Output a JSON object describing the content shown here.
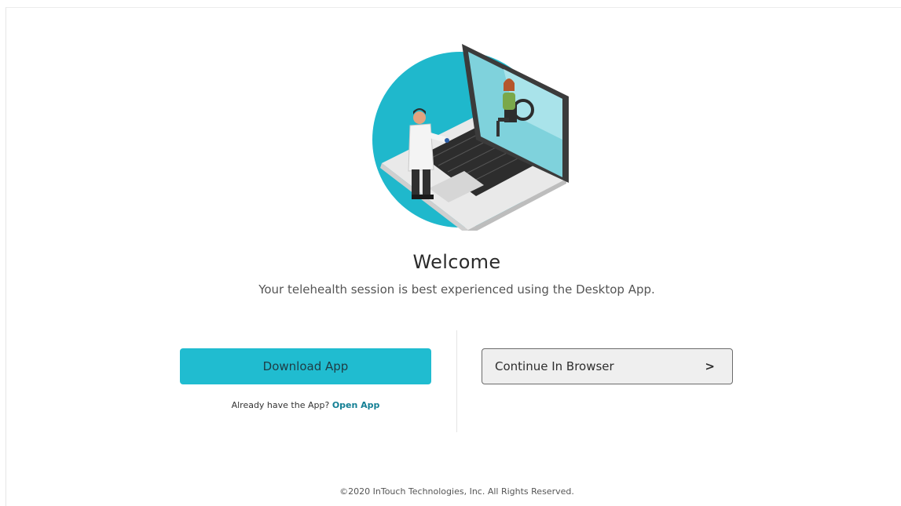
{
  "welcome": {
    "title": "Welcome",
    "subtitle": "Your telehealth session is best experienced using the Desktop App."
  },
  "actions": {
    "download_label": "Download App",
    "already_text": "Already have the App?",
    "open_app_label": "Open App",
    "browser_label": "Continue In Browser",
    "browser_chevron": ">"
  },
  "footer": {
    "copyright": "©2020 InTouch Technologies, Inc. All Rights Reserved."
  },
  "colors": {
    "accent": "#20bcd0",
    "link": "#137f94",
    "hero_circle": "#1fb8cc"
  },
  "icons": {
    "hero": "telehealth-doctor-laptop-illustration",
    "chevron": "chevron-right-icon"
  }
}
